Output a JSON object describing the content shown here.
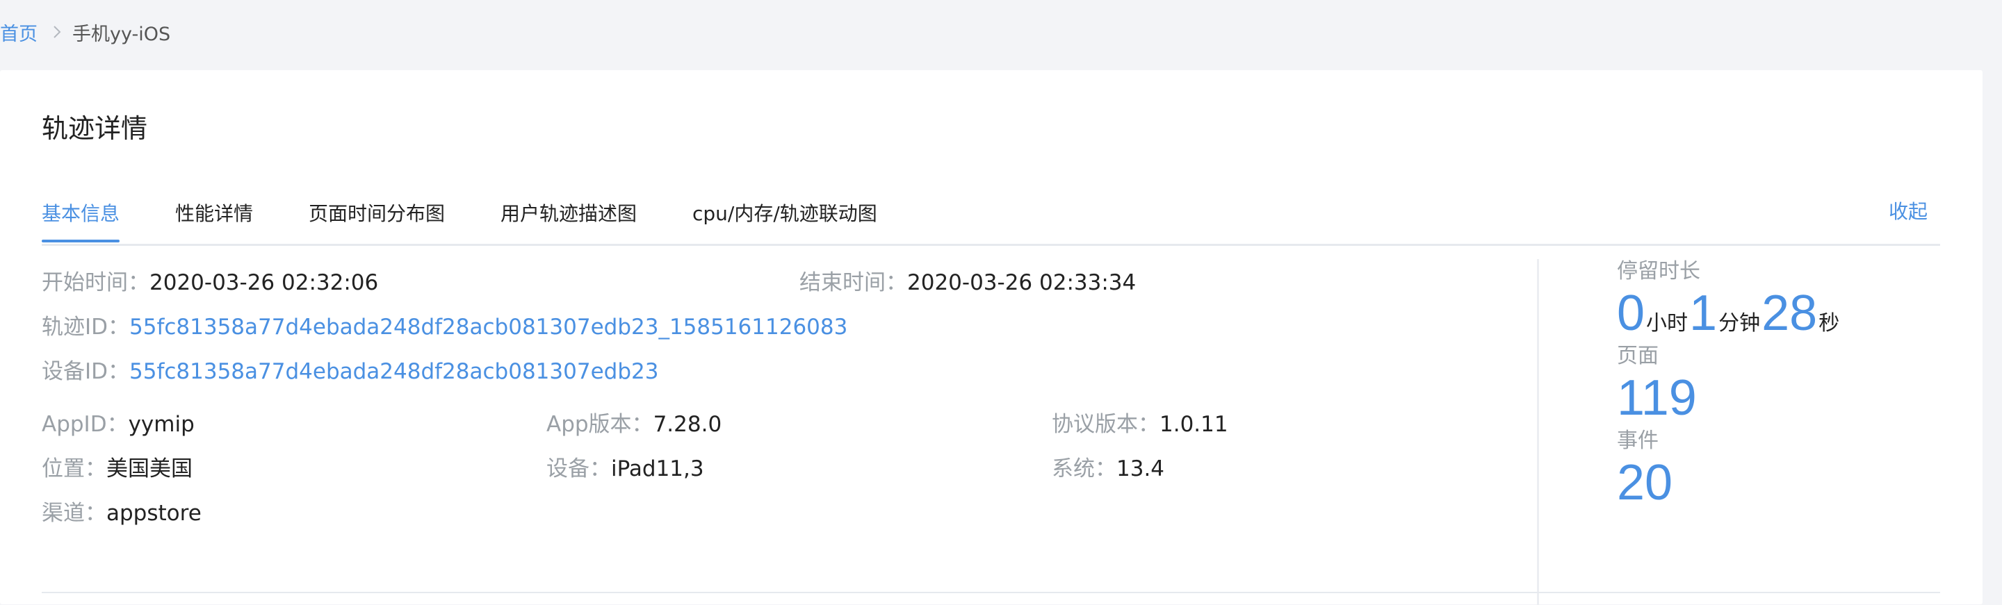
{
  "breadcrumb": {
    "home": "首页",
    "current": "手机yy-iOS"
  },
  "card": {
    "title": "轨迹详情"
  },
  "tabs": [
    {
      "label": "基本信息",
      "active": true
    },
    {
      "label": "性能详情",
      "active": false
    },
    {
      "label": "页面时间分布图",
      "active": false
    },
    {
      "label": "用户轨迹描述图",
      "active": false
    },
    {
      "label": "cpu/内存/轨迹联动图",
      "active": false
    }
  ],
  "collapse_label": "收起",
  "info": {
    "start_time": {
      "label": "开始时间：",
      "value": "2020-03-26 02:32:06"
    },
    "end_time": {
      "label": "结束时间：",
      "value": "2020-03-26 02:33:34"
    },
    "trace_id": {
      "label": "轨迹ID：",
      "value": "55fc81358a77d4ebada248df28acb081307edb23_1585161126083"
    },
    "device_id": {
      "label": "设备ID：",
      "value": "55fc81358a77d4ebada248df28acb081307edb23"
    },
    "app_id": {
      "label": "AppID：",
      "value": "yymip"
    },
    "app_version": {
      "label": "App版本：",
      "value": "7.28.0"
    },
    "protocol_version": {
      "label": "协议版本：",
      "value": "1.0.11"
    },
    "location": {
      "label": "位置：",
      "value": "美国美国"
    },
    "device": {
      "label": "设备：",
      "value": "iPad11,3"
    },
    "system": {
      "label": "系统：",
      "value": "13.4"
    },
    "channel": {
      "label": "渠道：",
      "value": "appstore"
    }
  },
  "stats": {
    "duration_label": "停留时长",
    "hours": "0",
    "hours_unit": "小时",
    "minutes": "1",
    "minutes_unit": "分钟",
    "seconds": "28",
    "seconds_unit": "秒",
    "pages_label": "页面",
    "pages": "119",
    "events_label": "事件",
    "events": "20"
  },
  "colors": {
    "accent": "#4a90e2",
    "label": "#9aa0a6",
    "text": "#222222",
    "background": "#f3f4f7"
  }
}
